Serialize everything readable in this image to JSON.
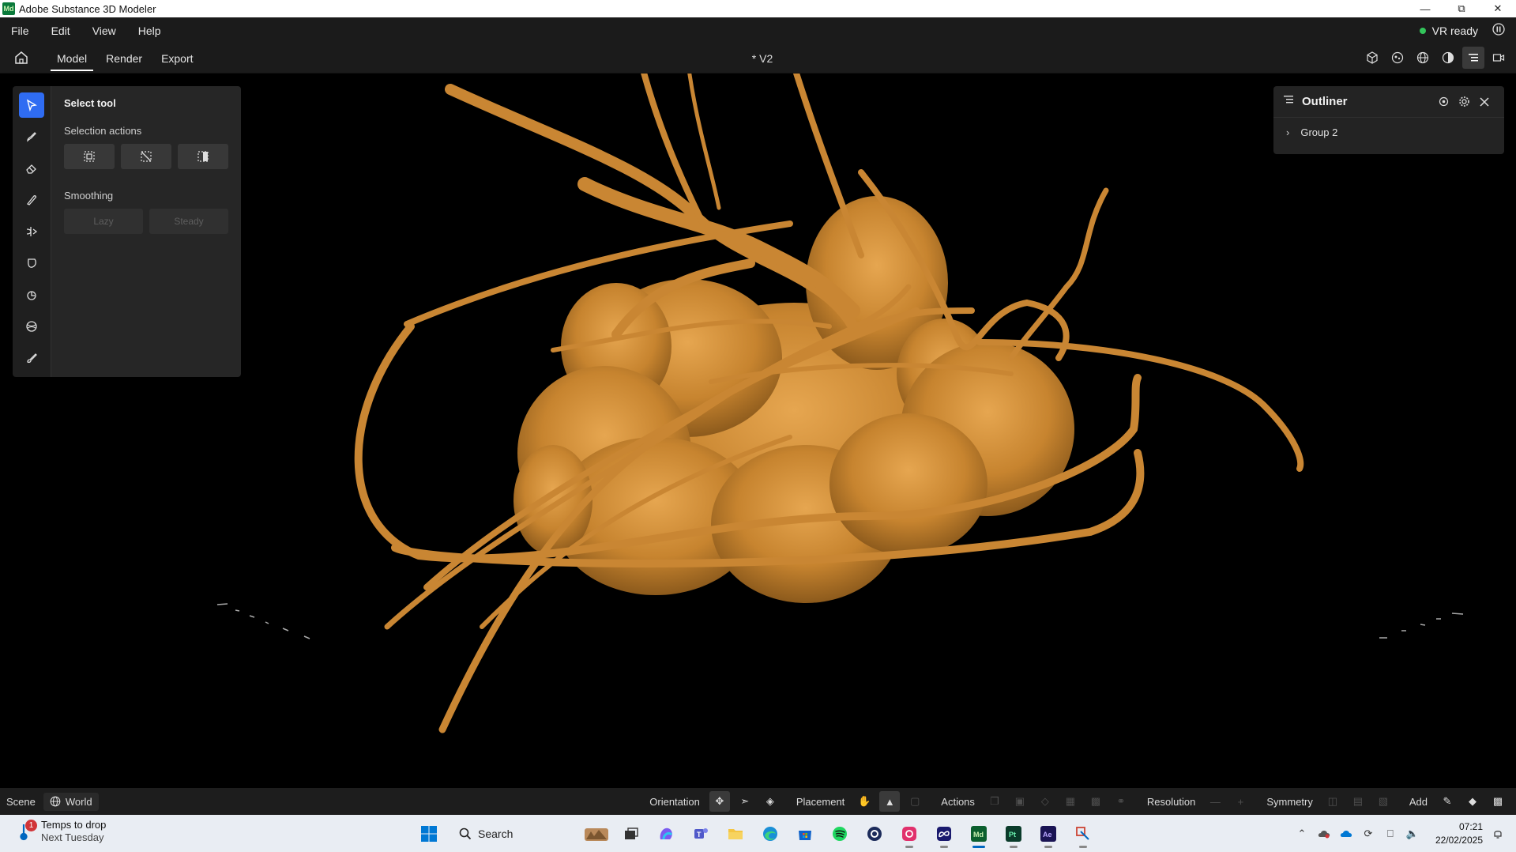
{
  "app": {
    "title": "Adobe Substance 3D Modeler",
    "logo_text": "Md",
    "window_controls": [
      "minimize",
      "maximize",
      "close"
    ]
  },
  "menu": {
    "items": [
      "File",
      "Edit",
      "View",
      "Help"
    ],
    "vr_status": "VR ready"
  },
  "tabs": {
    "items": [
      "Model",
      "Render",
      "Export"
    ],
    "active": "Model"
  },
  "document": {
    "title": "* V2"
  },
  "toolbar_right_icons": [
    "cube-icon",
    "environment-icon",
    "globe-icon",
    "material-icon",
    "outliner-icon",
    "camera-icon"
  ],
  "tool_rail": {
    "tools": [
      "select-tool-icon",
      "clay-tool-icon",
      "erase-tool-icon",
      "smooth-tool-icon",
      "move-tool-icon",
      "inflate-tool-icon",
      "flatten-tool-icon",
      "crease-tool-icon",
      "paint-tool-icon"
    ],
    "active_index": 0
  },
  "tool_panel": {
    "title": "Select tool",
    "selection_section": "Selection actions",
    "smoothing_section": "Smoothing",
    "smoothing_options": [
      "Lazy",
      "Steady"
    ]
  },
  "outliner": {
    "title": "Outliner",
    "items": [
      {
        "label": "Group 2"
      }
    ]
  },
  "statusbar": {
    "scene_label": "Scene",
    "space_label": "World",
    "orientation_label": "Orientation",
    "placement_label": "Placement",
    "actions_label": "Actions",
    "resolution_label": "Resolution",
    "symmetry_label": "Symmetry",
    "add_label": "Add"
  },
  "taskbar": {
    "weather_badge": "1",
    "weather_title": "Temps to drop",
    "weather_sub": "Next Tuesday",
    "search_placeholder": "Search",
    "time": "07:21",
    "date": "22/02/2025"
  },
  "colors": {
    "accent": "#2f6cf2",
    "model_color": "#c9852f",
    "vr_ready": "#33c55b"
  }
}
